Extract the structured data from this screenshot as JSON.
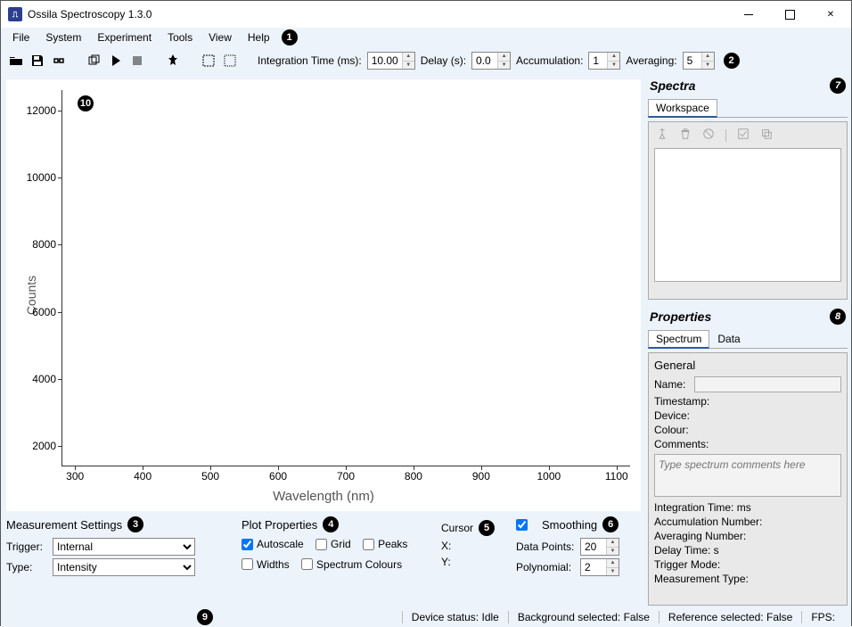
{
  "app": {
    "title": "Ossila Spectroscopy 1.3.0",
    "icon_text": "⎍"
  },
  "menu": {
    "items": [
      "File",
      "System",
      "Experiment",
      "Tools",
      "View",
      "Help"
    ]
  },
  "toolbar": {
    "integration_label": "Integration Time (ms):",
    "integration_value": "10.00",
    "delay_label": "Delay (s):",
    "delay_value": "0.0",
    "accumulation_label": "Accumulation:",
    "accumulation_value": "1",
    "averaging_label": "Averaging:",
    "averaging_value": "5"
  },
  "callouts": {
    "c1": "1",
    "c2": "2",
    "c3": "3",
    "c4": "4",
    "c5": "5",
    "c6": "6",
    "c7": "7",
    "c8": "8",
    "c9": "9",
    "c10": "10"
  },
  "chart_data": {
    "type": "line",
    "title": "",
    "xlabel": "Wavelength (nm)",
    "ylabel": "Counts",
    "xticks": [
      300,
      400,
      500,
      600,
      700,
      800,
      900,
      1000,
      1100
    ],
    "yticks": [
      2000,
      4000,
      6000,
      8000,
      10000,
      12000
    ],
    "xlim": [
      280,
      1120
    ],
    "ylim": [
      1400,
      12600
    ],
    "series": []
  },
  "bottom": {
    "measurement": {
      "title": "Measurement Settings",
      "trigger_label": "Trigger:",
      "trigger_value": "Internal",
      "type_label": "Type:",
      "type_value": "Intensity"
    },
    "plot": {
      "title": "Plot Properties",
      "autoscale": "Autoscale",
      "grid": "Grid",
      "peaks": "Peaks",
      "widths": "Widths",
      "spectrum_colours": "Spectrum Colours"
    },
    "cursor": {
      "title": "Cursor",
      "x": "X:",
      "y": "Y:"
    },
    "smoothing": {
      "title": "Smoothing",
      "datapoints_label": "Data Points:",
      "datapoints_value": "20",
      "polynomial_label": "Polynomial:",
      "polynomial_value": "2"
    }
  },
  "right": {
    "spectra_title": "Spectra",
    "workspace_tab": "Workspace",
    "properties_title": "Properties",
    "spectrum_tab": "Spectrum",
    "data_tab": "Data",
    "general_title": "General",
    "name_label": "Name:",
    "timestamp_label": "Timestamp:",
    "device_label": "Device:",
    "colour_label": "Colour:",
    "comments_label": "Comments:",
    "comments_placeholder": "Type spectrum comments here",
    "int_time": "Integration Time:  ms",
    "accum_num": "Accumulation Number:",
    "avg_num": "Averaging Number:",
    "delay_time": "Delay Time:  s",
    "trigger_mode": "Trigger Mode:",
    "meas_type": "Measurement Type:"
  },
  "status": {
    "device": "Device status: Idle",
    "bg": "Background selected: False",
    "ref": "Reference selected: False",
    "fps": "FPS:"
  }
}
